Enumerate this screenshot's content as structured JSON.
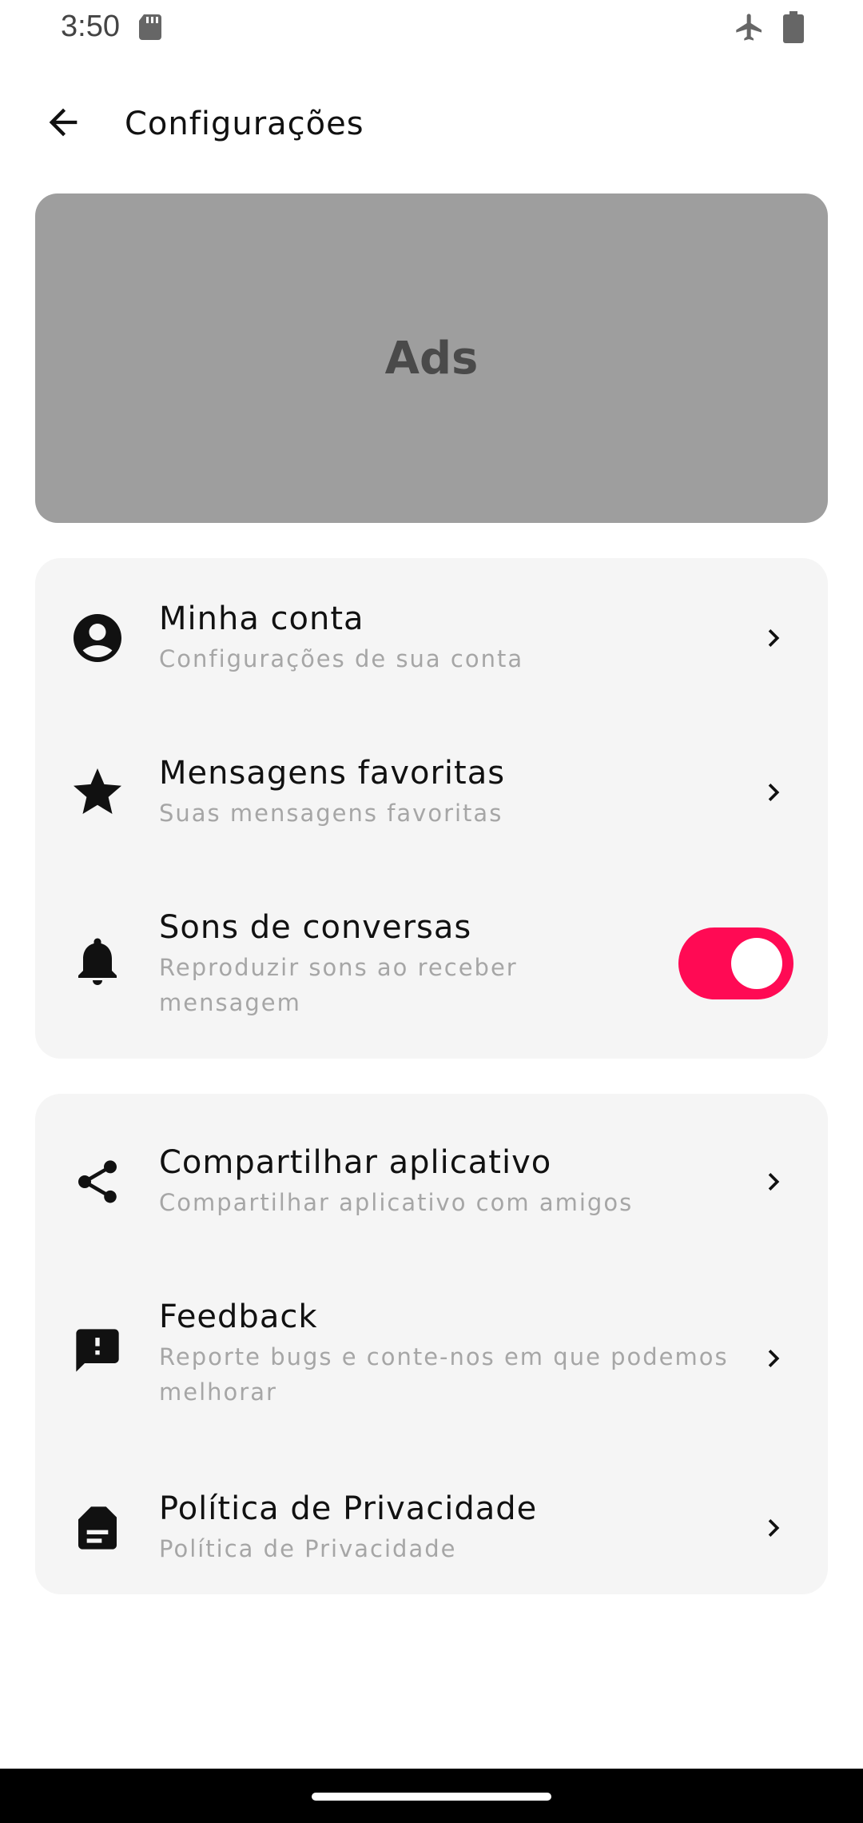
{
  "status_bar": {
    "time": "3:50",
    "icons": [
      "sd-card-icon",
      "airplane-mode-icon",
      "battery-icon"
    ]
  },
  "app_bar": {
    "back_icon": "arrow-back-icon",
    "title": "Configurações"
  },
  "ads": {
    "label": "Ads"
  },
  "section1": {
    "items": [
      {
        "icon": "account-circle-icon",
        "title": "Minha conta",
        "subtitle": "Configurações de sua conta"
      },
      {
        "icon": "star-icon",
        "title": "Mensagens favoritas",
        "subtitle": "Suas mensagens favoritas"
      },
      {
        "icon": "bell-icon",
        "title": "Sons de conversas",
        "subtitle": "Reproduzir sons ao receber mensagem",
        "toggle_on": true
      }
    ]
  },
  "section2": {
    "items": [
      {
        "icon": "share-icon",
        "title": "Compartilhar aplicativo",
        "subtitle": "Compartilhar aplicativo com amigos"
      },
      {
        "icon": "feedback-icon",
        "title": "Feedback",
        "subtitle": "Reporte bugs e conte-nos em que podemos melhorar"
      },
      {
        "icon": "document-icon",
        "title": "Política de Privacidade",
        "subtitle": "Política de Privacidade"
      }
    ]
  },
  "colors": {
    "accent": "#ff0a54",
    "ads_bg": "#9e9e9e",
    "card_bg": "#f5f5f5",
    "subtitle": "#a6a6a6"
  }
}
